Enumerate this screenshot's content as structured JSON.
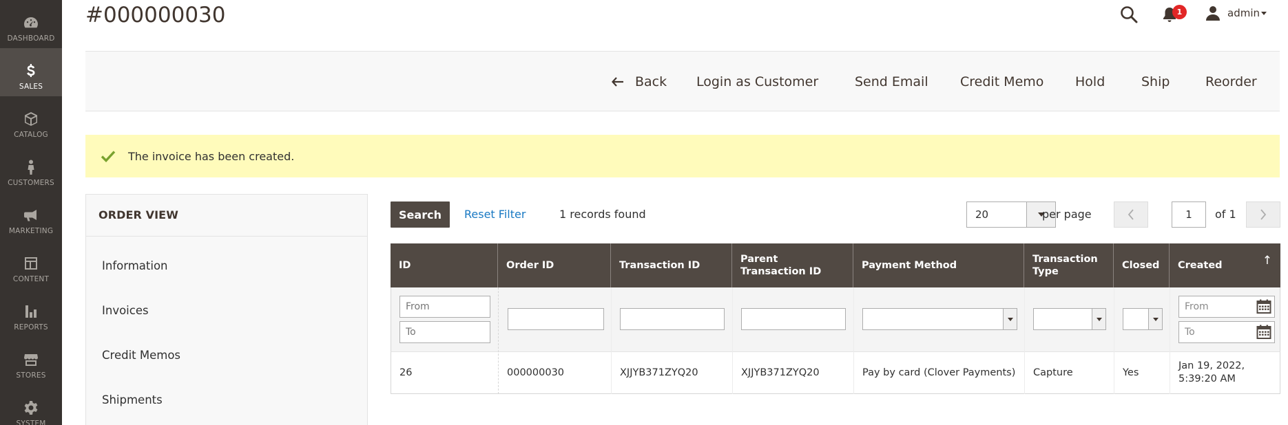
{
  "sidebar": {
    "items": [
      {
        "label": "DASHBOARD",
        "icon": "dashboard-icon",
        "active": false
      },
      {
        "label": "SALES",
        "icon": "dollar-icon",
        "active": true
      },
      {
        "label": "CATALOG",
        "icon": "box-icon",
        "active": false
      },
      {
        "label": "CUSTOMERS",
        "icon": "person-icon",
        "active": false
      },
      {
        "label": "MARKETING",
        "icon": "megaphone-icon",
        "active": false
      },
      {
        "label": "CONTENT",
        "icon": "layout-icon",
        "active": false
      },
      {
        "label": "REPORTS",
        "icon": "bar-chart-icon",
        "active": false
      },
      {
        "label": "STORES",
        "icon": "store-icon",
        "active": false
      },
      {
        "label": "SYSTEM",
        "icon": "gear-icon",
        "active": false
      }
    ]
  },
  "header": {
    "title": "#000000030",
    "notifications_count": "1",
    "user": "admin"
  },
  "actions": {
    "back": "Back",
    "login_as_customer": "Login as Customer",
    "send_email": "Send Email",
    "credit_memo": "Credit Memo",
    "hold": "Hold",
    "ship": "Ship",
    "reorder": "Reorder"
  },
  "message": {
    "text": "The invoice has been created.",
    "color": "#fffbbb"
  },
  "order_view": {
    "title": "ORDER VIEW",
    "items": [
      "Information",
      "Invoices",
      "Credit Memos",
      "Shipments"
    ]
  },
  "grid_controls": {
    "search": "Search",
    "reset_filter": "Reset Filter",
    "records_found": "1 records found",
    "per_page_value": "20",
    "per_page_label": "per page",
    "page": "1",
    "of_pages": "of 1"
  },
  "grid": {
    "columns": [
      "ID",
      "Order ID",
      "Transaction ID",
      "Parent Transaction ID",
      "Payment Method",
      "Transaction Type",
      "Closed",
      "Created"
    ],
    "filters": {
      "id_from": "From",
      "id_to": "To",
      "created_from": "From",
      "created_to": "To"
    },
    "rows": [
      {
        "id": "26",
        "order_id": "000000030",
        "transaction_id": "XJJYB371ZYQ20",
        "parent_transaction_id": "XJJYB371ZYQ20",
        "payment_method": "Pay by card (Clover Payments)",
        "transaction_type": "Capture",
        "closed": "Yes",
        "created": "Jan 19, 2022, 5:39:20 AM"
      }
    ]
  },
  "colors": {
    "sidebar": "#373330",
    "sidebar_active": "#524d49",
    "table_header": "#514943",
    "link": "#1979c3",
    "badge": "#e22626"
  }
}
